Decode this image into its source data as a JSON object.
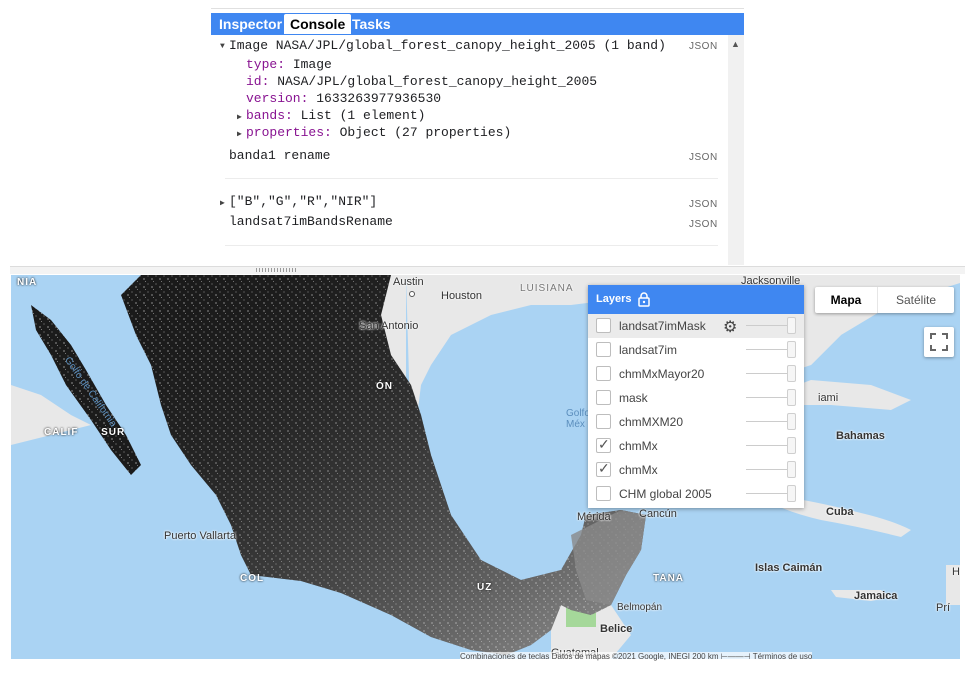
{
  "tabs": {
    "inspector": "Inspector",
    "console": "Console",
    "tasks": "Tasks"
  },
  "console": {
    "json_label": "JSON",
    "image_header": "Image NASA/JPL/global_forest_canopy_height_2005 (1 band)",
    "type_key": "type:",
    "type_val": " Image",
    "id_key": "id:",
    "id_val": " NASA/JPL/global_forest_canopy_height_2005",
    "version_key": "version:",
    "version_val": " 1633263977936530",
    "bands_key": "bands:",
    "bands_val": " List (1 element)",
    "properties_key": "properties:",
    "properties_val": " Object (27 properties)",
    "band_rename": "banda1 rename",
    "list_line": "[\"B\",\"G\",\"R\",\"NIR\"]",
    "landsat_rename": "landsat7imBandsRename"
  },
  "map": {
    "maptype": {
      "map": "Mapa",
      "satellite": "Satélite"
    },
    "labels": {
      "nia": "NIA",
      "austin": "Austin",
      "houston": "Houston",
      "luisiana": "LUISIANA",
      "jacksonville": "Jacksonville",
      "san_antonio": "San Antonio",
      "golfo_california": "Golfo de California",
      "on": "ÓN",
      "california_sur": "CALIF      SUR",
      "golfo_mexico": "Golfo\nMéx",
      "miami": "iami",
      "bahamas": "Bahamas",
      "merida": "Mérida",
      "cancun": "Cancún",
      "cuba": "Cuba",
      "puerto_vallarta": "Puerto Vallarta",
      "col": "COL",
      "uz": "UZ",
      "tana": "TANA",
      "islas_caiman": "Islas Caimán",
      "jamaica": "Jamaica",
      "belmopan": "Belmopán",
      "belice": "Belice",
      "guatemala": "Guatemal",
      "h": "H",
      "pri": "Prí"
    },
    "attribution": "Combinaciones de teclas   Datos de mapas ©2021 Google, INEGI    200 km ⊢——⊣    Términos de uso"
  },
  "layers": {
    "title": "Layers",
    "items": [
      {
        "name": "landsat7imMask",
        "checked": false,
        "selected": true
      },
      {
        "name": "landsat7im",
        "checked": false
      },
      {
        "name": "chmMxMayor20",
        "checked": false
      },
      {
        "name": "mask",
        "checked": false
      },
      {
        "name": "chmMXM20",
        "checked": false
      },
      {
        "name": "chmMx",
        "checked": true
      },
      {
        "name": "chmMx",
        "checked": true
      },
      {
        "name": "CHM global 2005",
        "checked": false
      }
    ]
  },
  "colors": {
    "accent": "#3f87f1",
    "water": "#aad3f3",
    "land": "#ececec"
  }
}
